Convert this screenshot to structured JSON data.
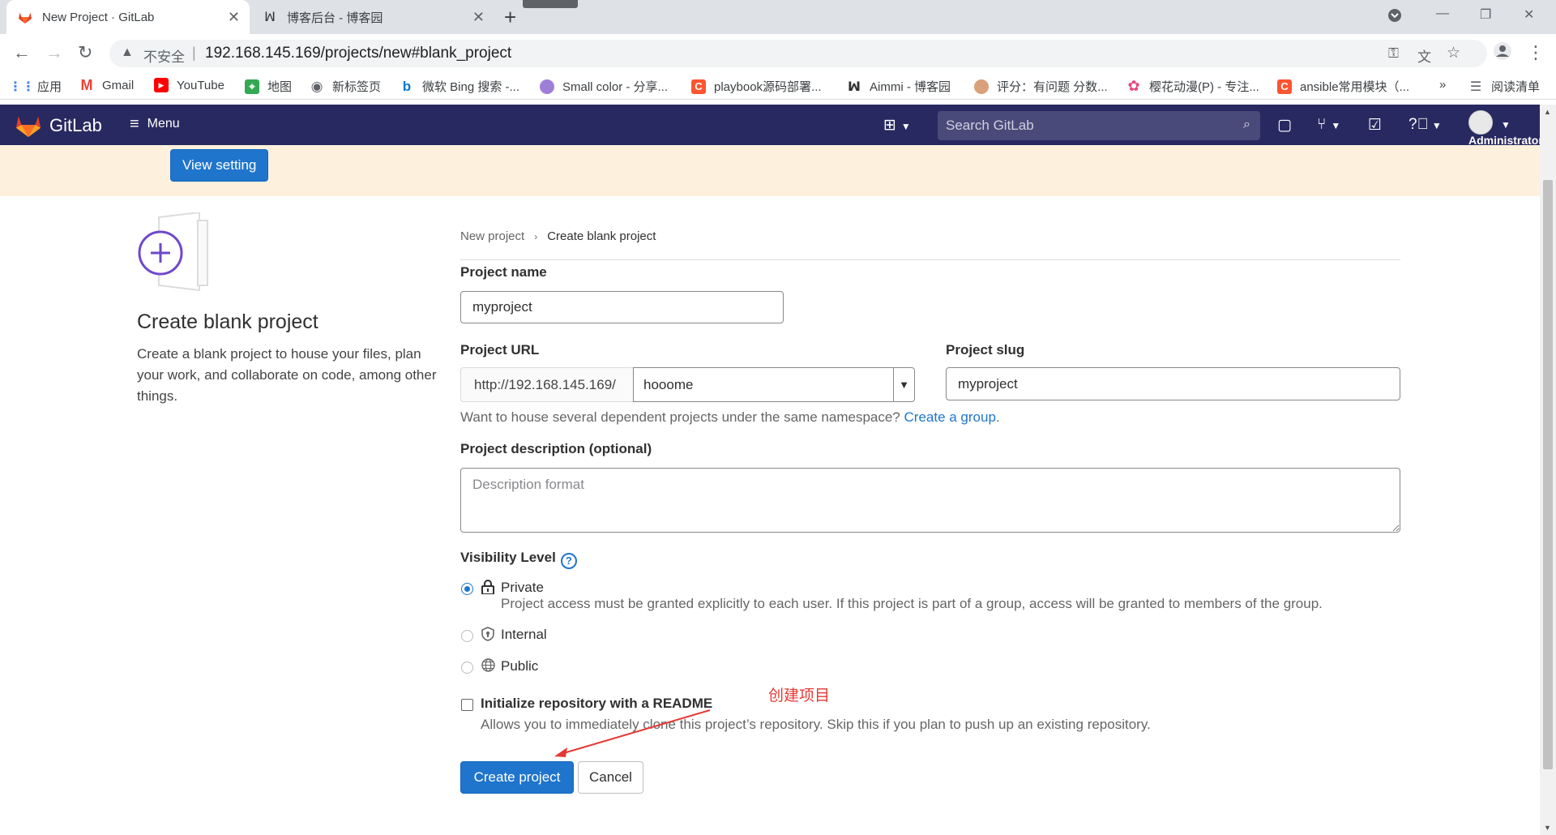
{
  "browser": {
    "tabs": [
      {
        "title": "New Project · GitLab",
        "active": true
      },
      {
        "title": "博客后台 - 博客园",
        "active": false
      }
    ],
    "address": {
      "security_label": "不安全",
      "url": "192.168.145.169/projects/new#blank_project"
    },
    "bookmarks": [
      {
        "label": "应用",
        "icon": "apps-grid-icon"
      },
      {
        "label": "Gmail",
        "icon": "gmail-icon"
      },
      {
        "label": "YouTube",
        "icon": "youtube-icon"
      },
      {
        "label": "地图",
        "icon": "maps-icon"
      },
      {
        "label": "新标签页",
        "icon": "globe-icon"
      },
      {
        "label": "微软 Bing 搜索 -...",
        "icon": "bing-icon"
      },
      {
        "label": "Small color - 分享...",
        "icon": "site-icon"
      },
      {
        "label": "playbook源码部署...",
        "icon": "csdn-icon"
      },
      {
        "label": "Aimmi - 博客园",
        "icon": "cnblogs-icon"
      },
      {
        "label": "评分：有问题 分数...",
        "icon": "site-icon"
      },
      {
        "label": "樱花动漫(P) - 专注...",
        "icon": "sakura-icon"
      },
      {
        "label": "ansible常用模块（...",
        "icon": "csdn-icon"
      }
    ],
    "reading_list_label": "阅读清单",
    "more_label": "»"
  },
  "gitlab_header": {
    "brand": "GitLab",
    "menu_label": "Menu",
    "search_placeholder": "Search GitLab",
    "username": "Administrator"
  },
  "banner": {
    "button_label": "View setting"
  },
  "left_panel": {
    "title": "Create blank project",
    "description": "Create a blank project to house your files, plan your work, and collaborate on code, among other things."
  },
  "breadcrumb": {
    "parent": "New project",
    "current": "Create blank project"
  },
  "form": {
    "project_name": {
      "label": "Project name",
      "value": "myproject"
    },
    "project_url": {
      "label": "Project URL",
      "prefix": "http://192.168.145.169/",
      "namespace": "hooome"
    },
    "project_slug": {
      "label": "Project slug",
      "value": "myproject"
    },
    "namespace_help": {
      "text": "Want to house several dependent projects under the same namespace? ",
      "link": "Create a group",
      "suffix": "."
    },
    "description": {
      "label": "Project description (optional)",
      "placeholder": "Description format"
    },
    "visibility": {
      "label": "Visibility Level",
      "options": [
        {
          "label": "Private",
          "selected": true,
          "icon": "lock-icon",
          "help": "Project access must be granted explicitly to each user. If this project is part of a group, access will be granted to members of the group."
        },
        {
          "label": "Internal",
          "selected": false,
          "icon": "shield-icon",
          "help": ""
        },
        {
          "label": "Public",
          "selected": false,
          "icon": "globe-icon",
          "help": ""
        }
      ]
    },
    "readme": {
      "label": "Initialize repository with a README",
      "checked": false,
      "help": "Allows you to immediately clone this project’s repository. Skip this if you plan to push up an existing repository."
    },
    "create_button": "Create project",
    "cancel_button": "Cancel"
  },
  "annotation": {
    "text": "创建项目",
    "color": "#e53935"
  },
  "colors": {
    "header_bg": "#292961",
    "banner_bg": "#fdf1dd",
    "primary": "#1f75cb"
  }
}
